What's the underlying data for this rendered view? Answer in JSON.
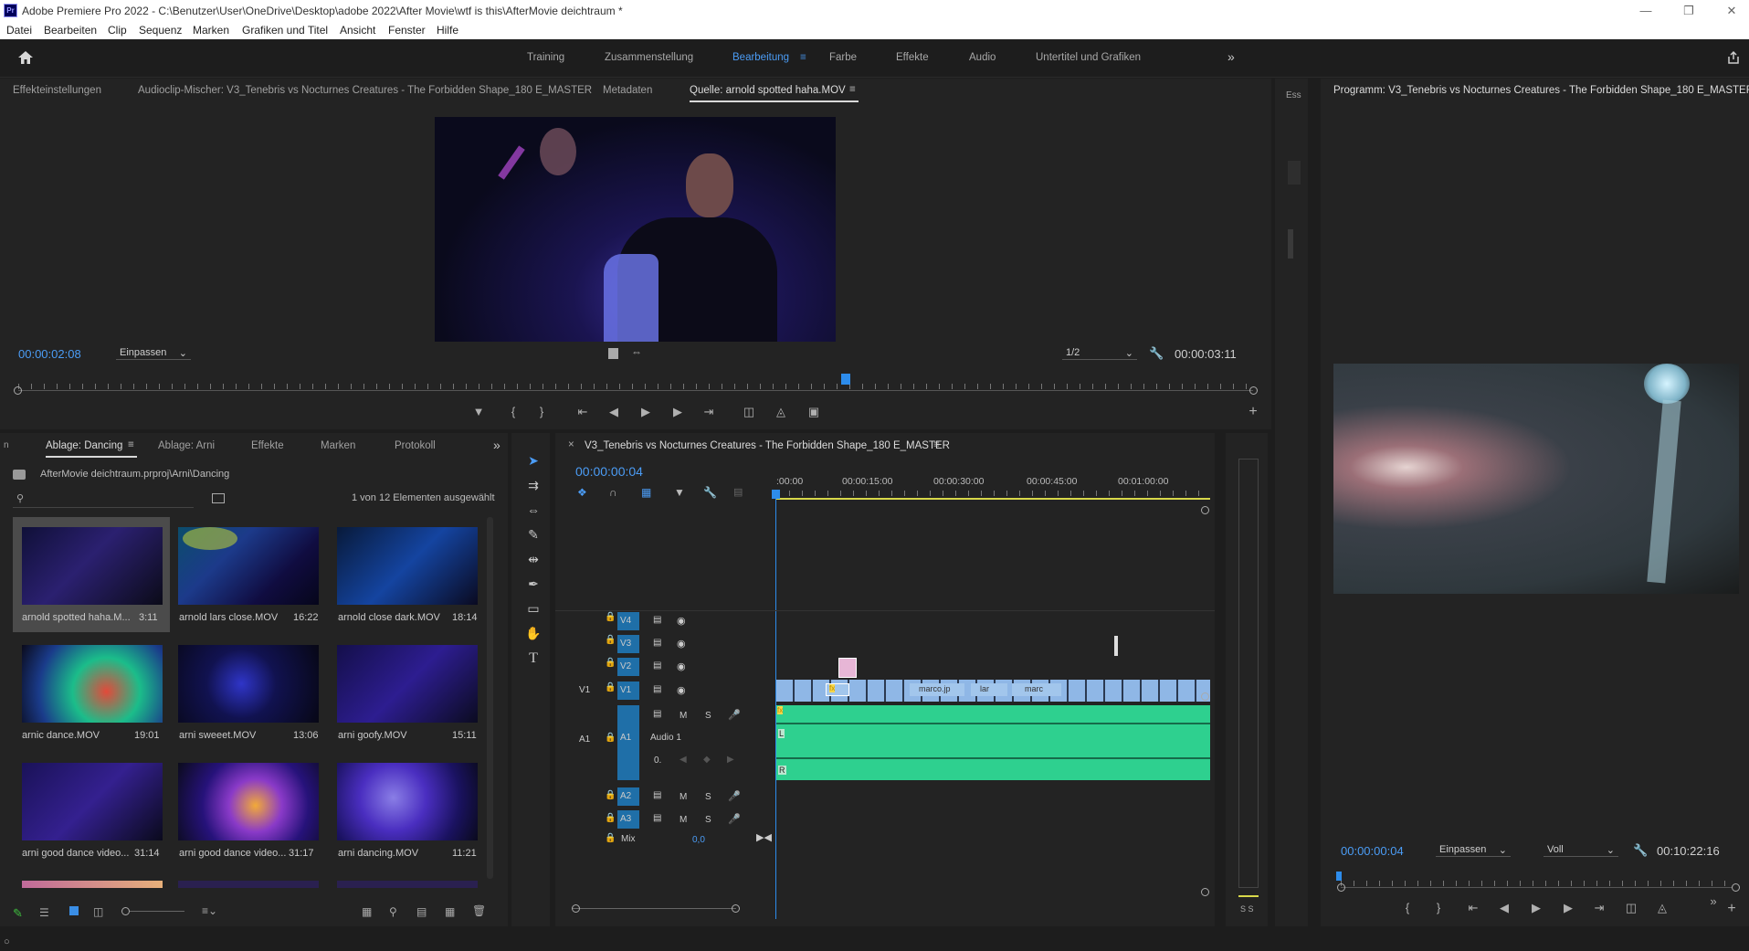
{
  "app": {
    "icon_label": "Pr",
    "title": "Adobe Premiere Pro 2022 - C:\\Benutzer\\User\\OneDrive\\Desktop\\adobe 2022\\After Movie\\wtf is this\\AfterMovie deichtraum *"
  },
  "menu": [
    "Datei",
    "Bearbeiten",
    "Clip",
    "Sequenz",
    "Marken",
    "Grafiken und Titel",
    "Ansicht",
    "Fenster",
    "Hilfe"
  ],
  "workspaces": [
    "Training",
    "Zusammenstellung",
    "Bearbeitung",
    "Farbe",
    "Effekte",
    "Audio",
    "Untertitel und Grafiken"
  ],
  "active_workspace": "Bearbeitung",
  "source_panel": {
    "tabs": [
      "Effekteinstellungen",
      "Audioclip-Mischer: V3_Tenebris vs Nocturnes Creatures - The Forbidden Shape_180 E_MASTER",
      "Metadaten",
      "Quelle: arnold spotted haha.MOV"
    ],
    "timecode": "00:00:02:08",
    "fit": "Einpassen",
    "resolution": "1/2",
    "duration": "00:00:03:11",
    "playhead_fraction": 0.67
  },
  "side_panel": {
    "label": "Ess"
  },
  "program_panel": {
    "title": "Programm: V3_Tenebris vs Nocturnes Creatures - The Forbidden Shape_180 E_MASTER",
    "timecode": "00:00:00:04",
    "fit": "Einpassen",
    "resolution": "Voll",
    "duration": "00:10:22:16"
  },
  "project_panel": {
    "tabs": [
      "Ablage: Dancing",
      "Ablage: Arni",
      "Effekte",
      "Marken",
      "Protokoll"
    ],
    "left_stub": "n",
    "path": "AfterMovie deichtraum.prproj\\Arni\\Dancing",
    "selection_info": "1 von 12 Elementen ausgewählt",
    "search_placeholder": "",
    "items": [
      {
        "name": "arnold spotted haha.M...",
        "duration": "3:11"
      },
      {
        "name": "arnold lars close.MOV",
        "duration": "16:22"
      },
      {
        "name": "arnold close dark.MOV",
        "duration": "18:14"
      },
      {
        "name": "arnic dance.MOV",
        "duration": "19:01"
      },
      {
        "name": "arni sweeet.MOV",
        "duration": "13:06"
      },
      {
        "name": "arni goofy.MOV",
        "duration": "15:11"
      },
      {
        "name": "arni good dance video...",
        "duration": "31:14"
      },
      {
        "name": "arni good dance video...",
        "duration": "31:17"
      },
      {
        "name": "arni dancing.MOV",
        "duration": "11:21"
      }
    ]
  },
  "timeline": {
    "sequence_name": "V3_Tenebris vs Nocturnes Creatures - The Forbidden Shape_180 E_MASTER",
    "timecode": "00:00:00:04",
    "ruler": [
      ":00:00",
      "00:00:15:00",
      "00:00:30:00",
      "00:00:45:00",
      "00:01:00:00"
    ],
    "video_tracks": [
      {
        "name": "V4",
        "target": "V4"
      },
      {
        "name": "V3",
        "target": "V3"
      },
      {
        "name": "V2",
        "target": "V2"
      },
      {
        "name": "V1",
        "target": "V1",
        "source": "V1"
      }
    ],
    "audio_tracks": [
      {
        "name": "A1",
        "source": "A1",
        "label": "Audio 1"
      },
      {
        "name": "A2"
      },
      {
        "name": "A3"
      }
    ],
    "m": "M",
    "s": "S",
    "mix_label": "Mix",
    "mix_value": "0,0",
    "clip_labels": [
      "marco.jp",
      "lar",
      "marc"
    ],
    "fx": "fx",
    "lr_left": "L",
    "lr_right": "R",
    "audio_db": "0."
  },
  "meter": {
    "labels": "S S"
  }
}
